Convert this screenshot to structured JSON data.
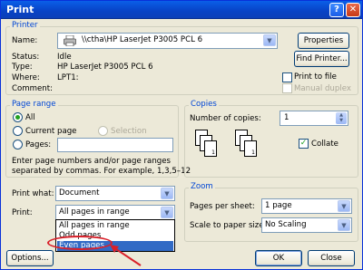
{
  "window": {
    "title": "Print",
    "help": "?",
    "close": "✕"
  },
  "printer": {
    "group": "Printer",
    "name_label": "Name:",
    "name_value": "\\\\ctha\\HP LaserJet P3005 PCL 6",
    "properties": "Properties",
    "status_label": "Status:",
    "status_value": "Idle",
    "type_label": "Type:",
    "type_value": "HP LaserJet P3005 PCL 6",
    "where_label": "Where:",
    "where_value": "LPT1:",
    "comment_label": "Comment:",
    "find_printer": "Find Printer...",
    "print_to_file": "Print to file",
    "manual_duplex": "Manual duplex"
  },
  "page_range": {
    "group": "Page range",
    "all": "All",
    "current_page": "Current page",
    "selection": "Selection",
    "pages": "Pages:",
    "help_line1": "Enter page numbers and/or page ranges",
    "help_line2": "separated by commas. For example, 1,3,5–12"
  },
  "copies": {
    "group": "Copies",
    "number_label": "Number of copies:",
    "number_value": "1",
    "collate": "Collate",
    "collate_checked": true
  },
  "print_what": {
    "label": "Print what:",
    "value": "Document"
  },
  "print": {
    "label": "Print:",
    "value": "All pages in range",
    "options": [
      "All pages in range",
      "Odd pages",
      "Even pages"
    ],
    "selected_index": 2
  },
  "zoom": {
    "group": "Zoom",
    "pages_per_sheet_label": "Pages per sheet:",
    "pages_per_sheet_value": "1 page",
    "scale_label": "Scale to paper size:",
    "scale_value": "No Scaling"
  },
  "buttons": {
    "options": "Options...",
    "ok": "OK",
    "close": "Close"
  },
  "annotation_color": "#d9202a"
}
